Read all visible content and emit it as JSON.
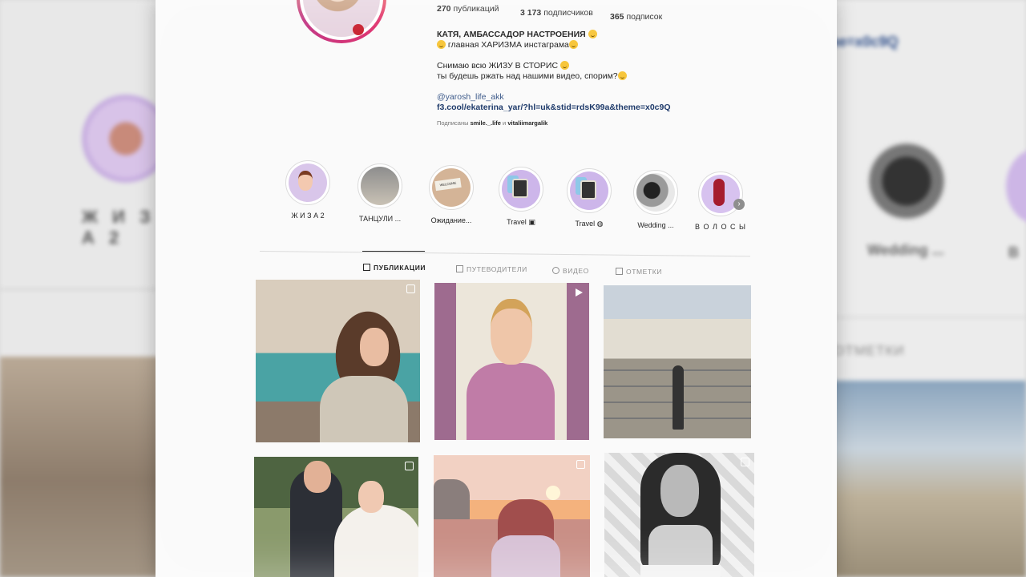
{
  "background": {
    "left_story_label": "Ж И З А 2",
    "right_link": "me=x0c9Q",
    "right_story_label": "Wedding ...",
    "right_story_label2": "В",
    "right_tab_label": "ОТМЕТКИ"
  },
  "profile": {
    "stats": {
      "posts": "270",
      "posts_label": "публикаций",
      "followers": "3 173",
      "followers_label": "подписчиков",
      "following": "365",
      "following_label": "подписок"
    },
    "name": "КАТЯ, АМБАССАДОР НАСТРОЕНИЯ",
    "bio_line1": "главная ХАРИЗМА инстаграма",
    "bio_line2": "Снимаю всю ЖИЗУ В СТОРИС",
    "bio_line3": "ты будешь ржать над нашими видео, спорим?",
    "handle": "@yarosh_life_akk",
    "link": "f3.cool/ekaterina_yar/?hl=uk&stid=rdsK99a&theme=x0c9Q",
    "followed_prefix": "Подписаны",
    "followed_user1": "smile._.life",
    "followed_and": "и",
    "followed_user2": "vitaliimargalik"
  },
  "highlights": [
    {
      "label": "Ж И З А 2"
    },
    {
      "label": "ТАНЦУЛИ ..."
    },
    {
      "label": "Ожидание..."
    },
    {
      "label": "Travel"
    },
    {
      "label": "Travel"
    },
    {
      "label": "Wedding ..."
    },
    {
      "label": "В О Л О С Ы"
    }
  ],
  "tabs": [
    {
      "label": "ПУБЛИКАЦИИ"
    },
    {
      "label": "ПУТЕВОДИТЕЛИ"
    },
    {
      "label": "ВИДЕО"
    },
    {
      "label": "ОТМЕТКИ"
    }
  ],
  "icons": {
    "next": "chevron-right-icon",
    "multi": "multiple-posts-icon",
    "reel": "play-icon"
  }
}
